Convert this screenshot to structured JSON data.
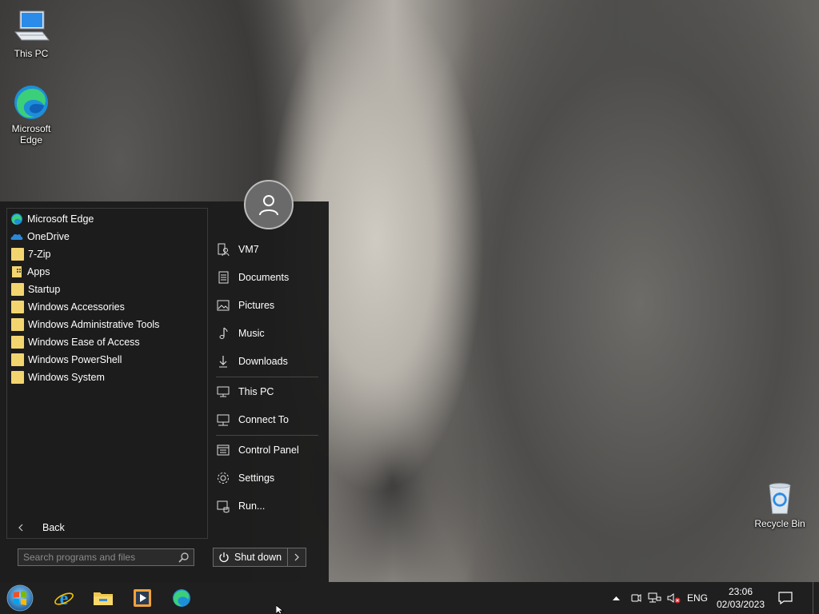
{
  "desktop": {
    "icons": [
      {
        "label": "This PC"
      },
      {
        "label": "Microsoft Edge"
      },
      {
        "label": "Recycle Bin"
      }
    ]
  },
  "start_menu": {
    "programs": [
      {
        "label": "Microsoft Edge",
        "icon": "edge-icon"
      },
      {
        "label": "OneDrive",
        "icon": "onedrive-icon"
      },
      {
        "label": "7-Zip",
        "icon": "folder-icon"
      },
      {
        "label": "Apps",
        "icon": "apps-folder-icon"
      },
      {
        "label": "Startup",
        "icon": "folder-icon"
      },
      {
        "label": "Windows Accessories",
        "icon": "folder-icon"
      },
      {
        "label": "Windows Administrative Tools",
        "icon": "folder-icon"
      },
      {
        "label": "Windows Ease of Access",
        "icon": "folder-icon"
      },
      {
        "label": "Windows PowerShell",
        "icon": "folder-icon"
      },
      {
        "label": "Windows System",
        "icon": "folder-icon"
      }
    ],
    "back_label": "Back",
    "search_placeholder": "Search programs and files",
    "places": [
      {
        "label": "VM7",
        "icon": "user-folder-icon"
      },
      {
        "label": "Documents",
        "icon": "document-icon"
      },
      {
        "label": "Pictures",
        "icon": "picture-icon"
      },
      {
        "label": "Music",
        "icon": "music-note-icon"
      },
      {
        "label": "Downloads",
        "icon": "download-icon"
      },
      {
        "label": "This PC",
        "icon": "computer-icon"
      },
      {
        "label": "Connect To",
        "icon": "connect-icon"
      },
      {
        "label": "Control Panel",
        "icon": "control-panel-icon"
      },
      {
        "label": "Settings",
        "icon": "gear-icon"
      },
      {
        "label": "Run...",
        "icon": "run-icon"
      }
    ],
    "shutdown_label": "Shut down"
  },
  "taskbar": {
    "language": "ENG",
    "time": "23:06",
    "date": "02/03/2023"
  },
  "colors": {
    "menu_bg": "#1c1c1c",
    "taskbar_bg": "#1f1f1f",
    "folder_yellow": "#f3d570"
  }
}
